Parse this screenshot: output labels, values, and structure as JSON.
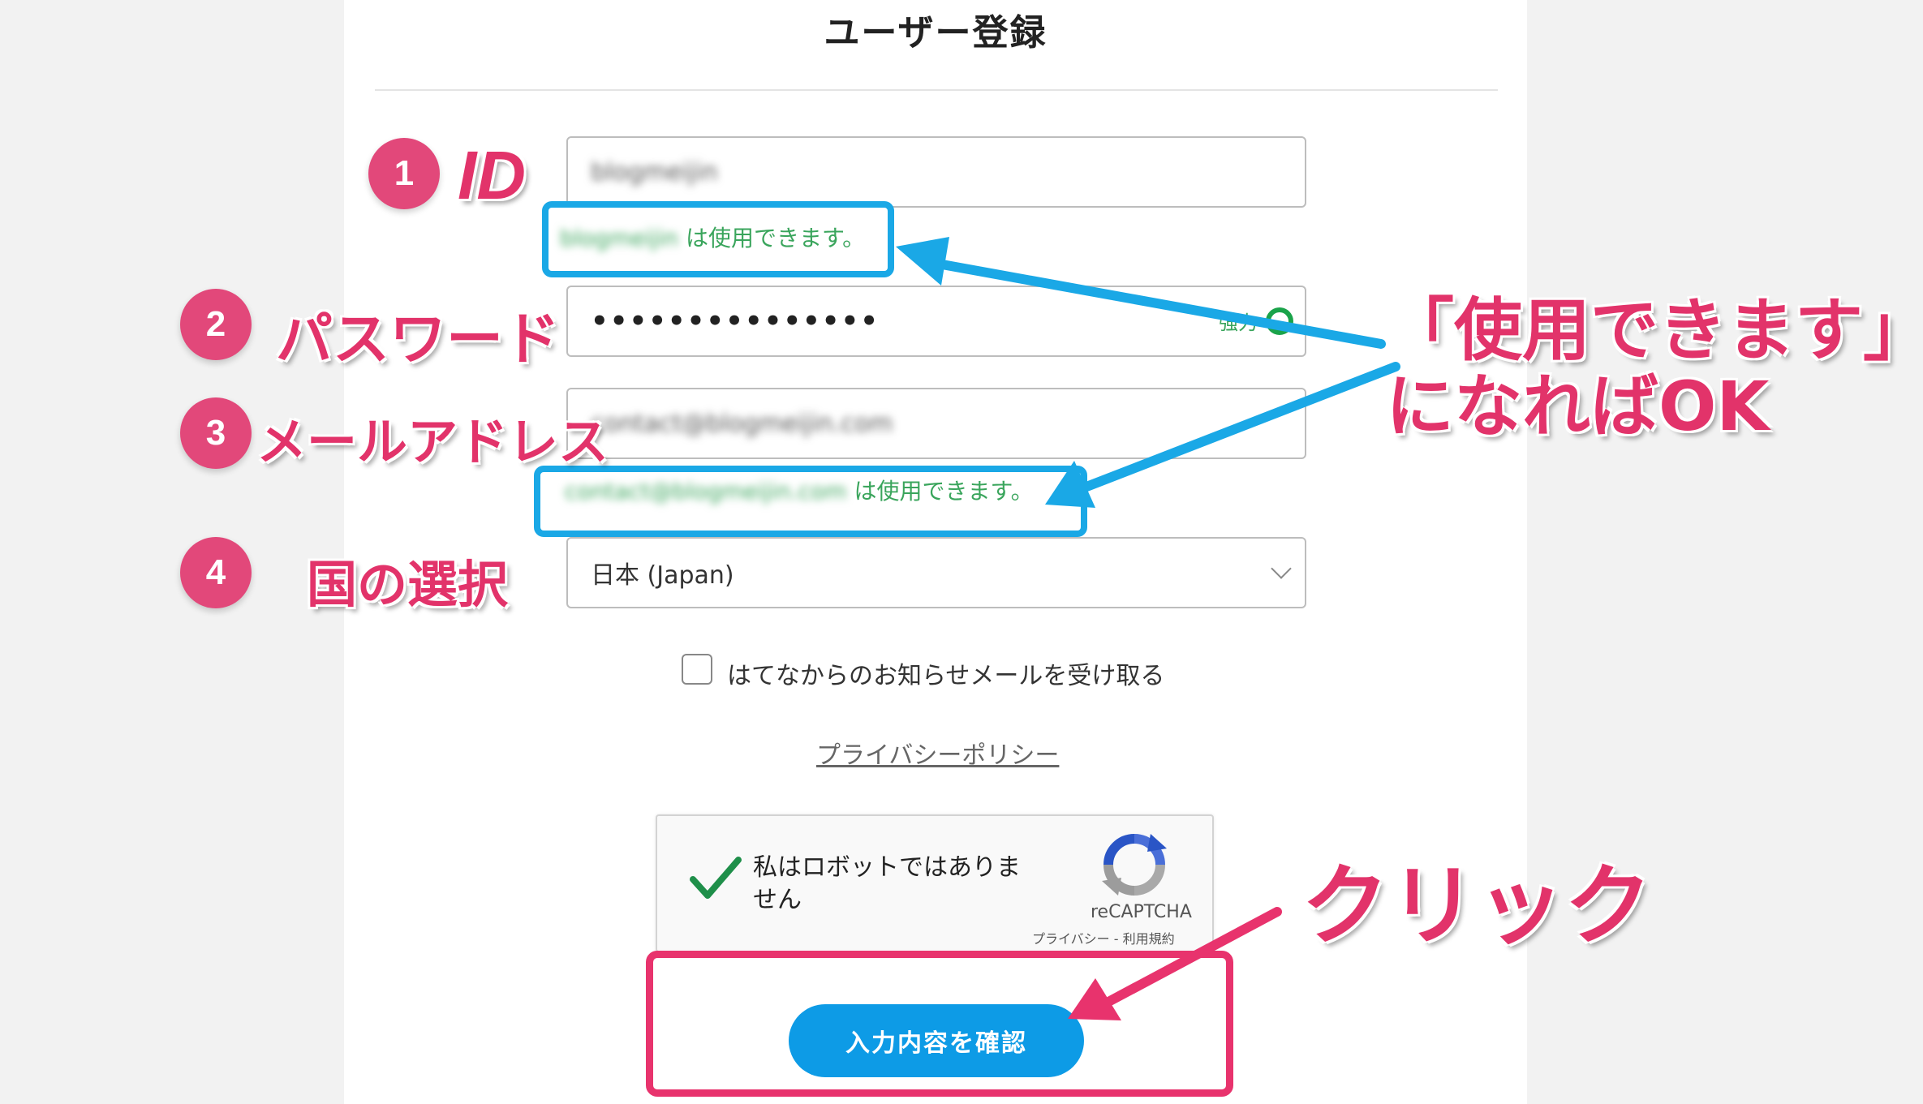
{
  "page": {
    "title": "ユーザー登録"
  },
  "form": {
    "id_value": "blogmeijin",
    "id_status_name": "blogmeijin",
    "available_text": "は使用できます。",
    "password_masked": "•••••••••••••••",
    "password_strength": "強力",
    "email_value": "contact@blogmeijin.com",
    "email_status_name": "contact@blogmeijin.com",
    "country_value": "日本 (Japan)",
    "newsletter_label": "はてなからのお知らせメールを受け取る",
    "privacy_link": "プライバシーポリシー",
    "submit_label": "入力内容を確認"
  },
  "recaptcha": {
    "checked": true,
    "text": "私はロボットではありません",
    "brand": "reCAPTCHA",
    "terms": "プライバシー - 利用規約"
  },
  "annotations": {
    "steps": [
      {
        "number": "1",
        "label": "ID"
      },
      {
        "number": "2",
        "label": "パスワード"
      },
      {
        "number": "3",
        "label": "メールアドレス"
      },
      {
        "number": "4",
        "label": "国の選択"
      }
    ],
    "callout_available_line1": "「使用できます」",
    "callout_available_line2": "になればOK",
    "callout_click": "クリック",
    "accent_pink": "#e2336a",
    "accent_blue": "#1aa8e6"
  }
}
